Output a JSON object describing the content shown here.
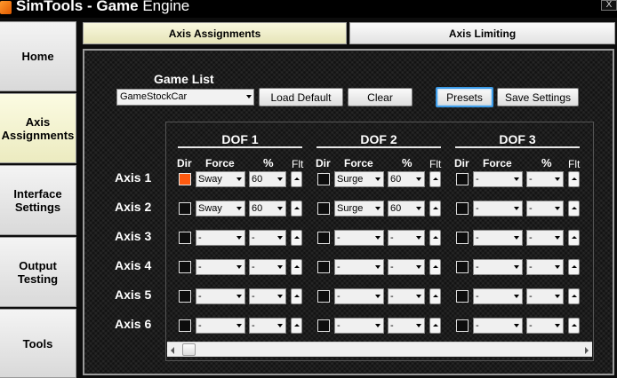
{
  "window": {
    "title_app": "SimTools - ",
    "title_bold": "Game",
    "title_suffix": " Engine",
    "close_label": "X"
  },
  "nav": {
    "home": "Home",
    "axis_assignments_line1": "Axis",
    "axis_assignments_line2": "Assignments",
    "interface_settings_line1": "Interface",
    "interface_settings_line2": "Settings",
    "output_testing_line1": "Output",
    "output_testing_line2": "Testing",
    "tools": "Tools",
    "active": "Axis Assignments"
  },
  "tabs": {
    "axis_assignments": "Axis Assignments",
    "axis_limiting": "Axis Limiting",
    "active": "Axis Assignments"
  },
  "game_list": {
    "label": "Game List",
    "selected": "GameStockCar"
  },
  "buttons": {
    "load_default": "Load Default",
    "clear": "Clear",
    "presets": "Presets",
    "save_settings": "Save Settings"
  },
  "dof_headers": [
    "DOF 1",
    "DOF 2",
    "DOF 3"
  ],
  "column_headers": {
    "dir": "Dir",
    "force": "Force",
    "percent": "%",
    "flt": "Flt"
  },
  "axes": [
    {
      "label": "Axis 1",
      "dof": [
        {
          "dir": true,
          "force": "Sway",
          "percent": "60"
        },
        {
          "dir": false,
          "force": "Surge",
          "percent": "60"
        },
        {
          "dir": false,
          "force": "-",
          "percent": "-"
        }
      ]
    },
    {
      "label": "Axis 2",
      "dof": [
        {
          "dir": false,
          "force": "Sway",
          "percent": "60"
        },
        {
          "dir": false,
          "force": "Surge",
          "percent": "60"
        },
        {
          "dir": false,
          "force": "-",
          "percent": "-"
        }
      ]
    },
    {
      "label": "Axis 3",
      "dof": [
        {
          "dir": false,
          "force": "-",
          "percent": "-"
        },
        {
          "dir": false,
          "force": "-",
          "percent": "-"
        },
        {
          "dir": false,
          "force": "-",
          "percent": "-"
        }
      ]
    },
    {
      "label": "Axis 4",
      "dof": [
        {
          "dir": false,
          "force": "-",
          "percent": "-"
        },
        {
          "dir": false,
          "force": "-",
          "percent": "-"
        },
        {
          "dir": false,
          "force": "-",
          "percent": "-"
        }
      ]
    },
    {
      "label": "Axis 5",
      "dof": [
        {
          "dir": false,
          "force": "-",
          "percent": "-"
        },
        {
          "dir": false,
          "force": "-",
          "percent": "-"
        },
        {
          "dir": false,
          "force": "-",
          "percent": "-"
        }
      ]
    },
    {
      "label": "Axis 6",
      "dof": [
        {
          "dir": false,
          "force": "-",
          "percent": "-"
        },
        {
          "dir": false,
          "force": "-",
          "percent": "-"
        },
        {
          "dir": false,
          "force": "-",
          "percent": "-"
        }
      ]
    }
  ],
  "colors": {
    "accent_checked": "#ff5a10",
    "focus_border": "#3d9ce8",
    "active_tab": "#f9f8df"
  }
}
